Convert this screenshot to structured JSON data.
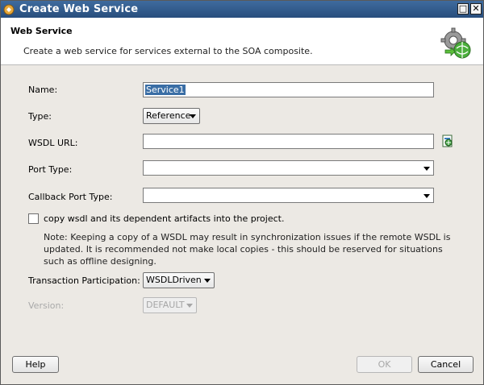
{
  "window": {
    "title": "Create Web Service",
    "maximize_glyph": "□",
    "close_glyph": "✕"
  },
  "header": {
    "title": "Web Service",
    "subtitle": "Create a web service for services external to the SOA composite.",
    "icon": "gear-globe-icon"
  },
  "form": {
    "name_label": "Name:",
    "name_value": "Service1",
    "type_label": "Type:",
    "type_value": "Reference",
    "wsdl_label": "WSDL URL:",
    "wsdl_value": "",
    "port_type_label": "Port Type:",
    "port_type_value": "",
    "callback_label": "Callback Port Type:",
    "callback_value": "",
    "copy_wsdl_label": "copy wsdl and its dependent artifacts into the project.",
    "copy_wsdl_checked": false,
    "note": "Note: Keeping a copy of a WSDL may result in synchronization issues if the remote WSDL is updated. It is recommended not make local copies - this should be reserved for situations such as offline designing.",
    "transaction_label": "Transaction Participation:",
    "transaction_value": "WSDLDriven",
    "version_label": "Version:",
    "version_value": "DEFAULT"
  },
  "buttons": {
    "help": "Help",
    "ok": "OK",
    "cancel": "Cancel"
  },
  "colors": {
    "titlebar": "#2f5a8c",
    "selection": "#3a6ea5"
  }
}
